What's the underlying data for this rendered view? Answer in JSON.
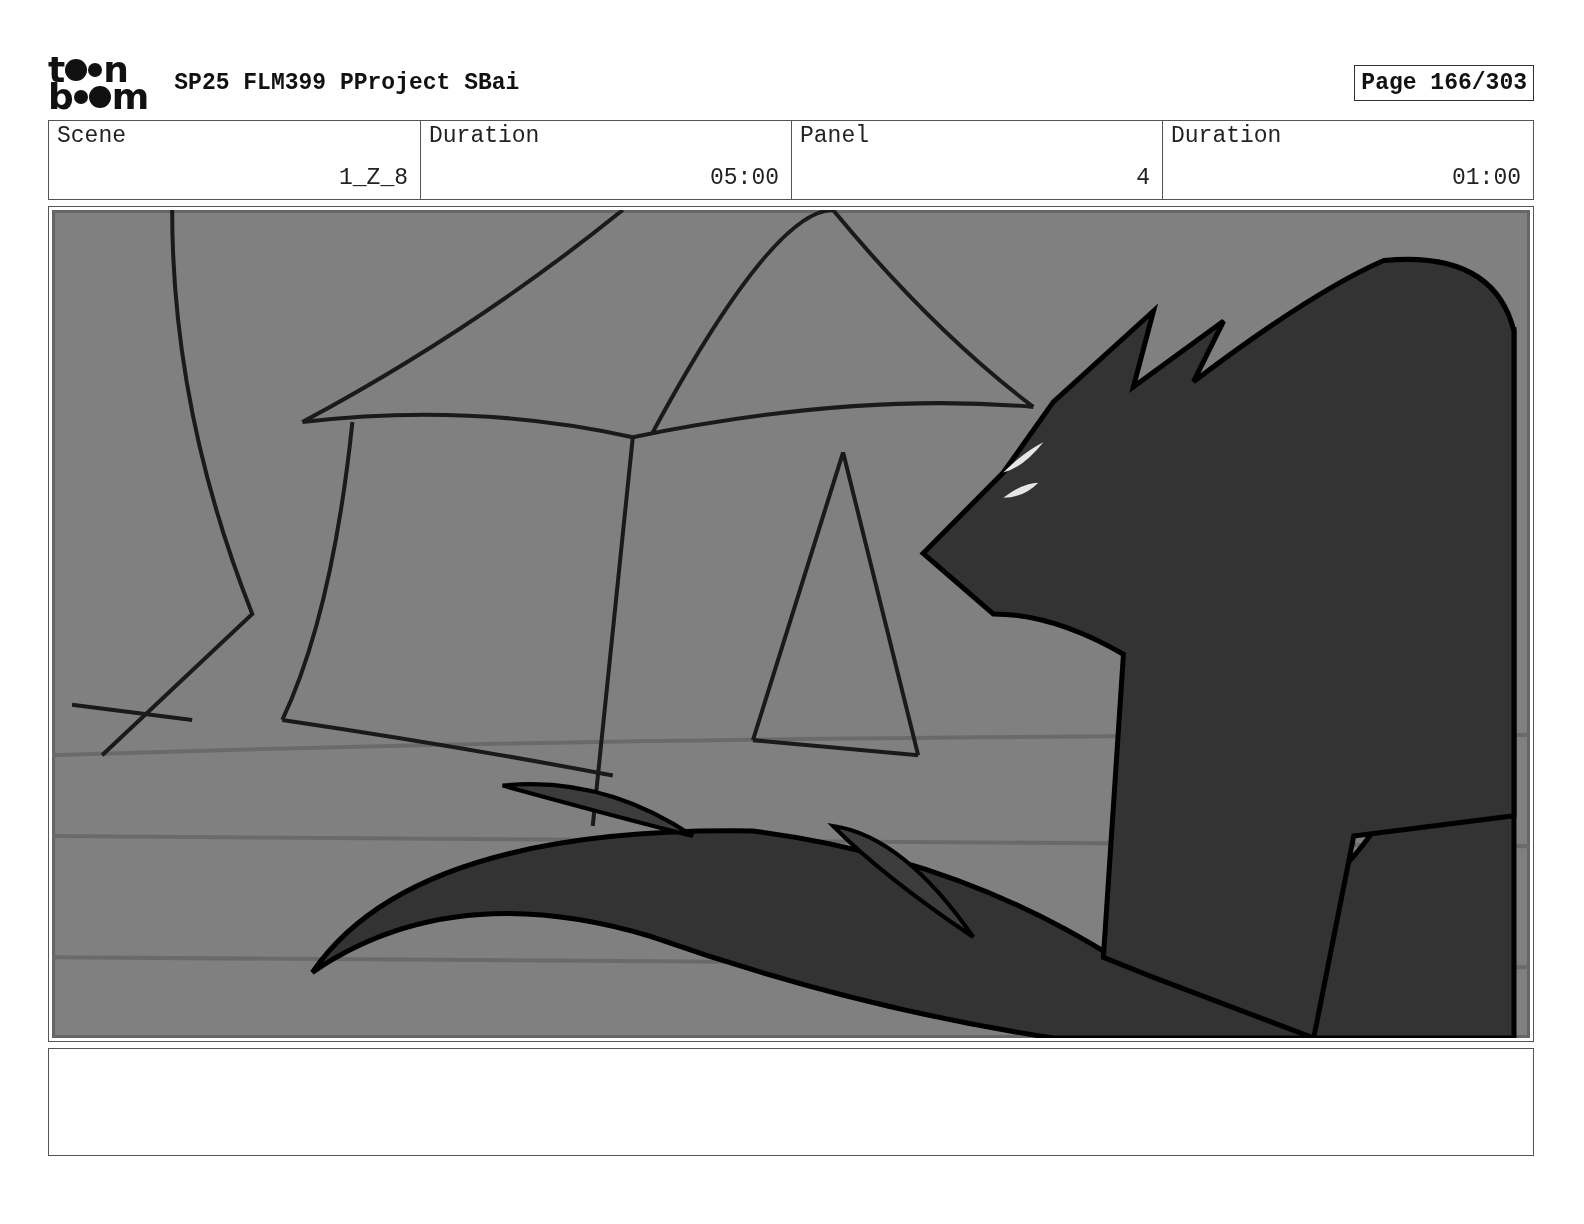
{
  "logo": {
    "top": [
      "t",
      "n"
    ],
    "bottom": [
      "b",
      "m"
    ]
  },
  "title": "SP25 FLM399 PProject SBai",
  "page": "Page 166/303",
  "fields": [
    {
      "label": "Scene",
      "value": "1_Z_8"
    },
    {
      "label": "Duration",
      "value": "05:00"
    },
    {
      "label": "Panel",
      "value": "4"
    },
    {
      "label": "Duration",
      "value": "01:00"
    }
  ]
}
